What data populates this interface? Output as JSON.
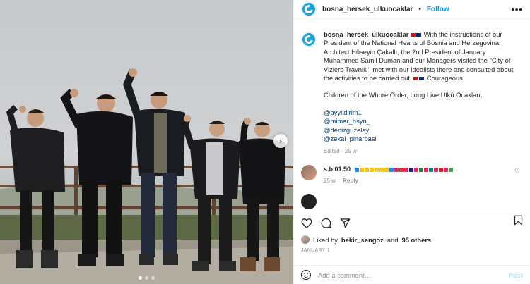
{
  "account": {
    "username": "bosna_hersek_ulkuocaklar",
    "separator": "•",
    "follow_label": "Follow",
    "more_label": "•••"
  },
  "caption": {
    "username": "bosna_hersek_ulkuocaklar",
    "text_main": "With the instructions of our President of the National Hearts of Bosnia and Herzegovina, Architect Hüseyin Çakallı, the 2nd President of January Muhammed Şamil Duman and our Managers visited the \"City of Viziers Travnik\", met with our Idealists there and consulted about the activities to be carried out.",
    "text_tail": "Courageous",
    "line2": "Children of the Whore Order, Long Live Ülkü Ocakları.",
    "mentions": [
      "@ayyildirim1",
      "@mimar_hsyn_",
      "@denizguzelay",
      "@zekai_pinarbasi"
    ],
    "meta": "Edited · 25 w"
  },
  "comment": {
    "username": "s.b.01.50",
    "time": "25 w",
    "reply_label": "Reply",
    "heart_icon": "heart-outline-icon"
  },
  "actions": {
    "icons": [
      "heart-icon",
      "comment-icon",
      "share-icon",
      "bookmark-icon"
    ],
    "liked_by_prefix": "Liked by",
    "liked_by_user": "bekir_sengoz",
    "liked_by_and": "and",
    "liked_by_others": "95 others",
    "date": "JANUARY 1"
  },
  "compose": {
    "placeholder": "Add a comment…",
    "post_label": "Post"
  },
  "carousel": {
    "next_label": "›"
  },
  "colors": {
    "brand_blue": "#1da1d8",
    "link_blue": "#0095f6",
    "mention_blue": "#00376b",
    "muted": "#8e8e8e"
  }
}
